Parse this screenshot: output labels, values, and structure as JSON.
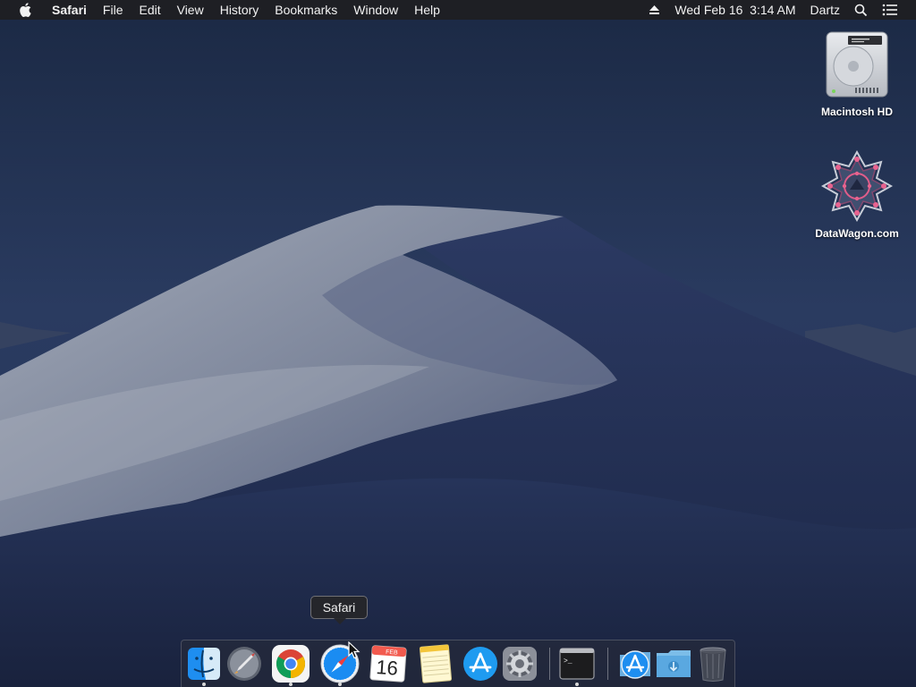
{
  "menubar": {
    "apple_icon": "apple-icon",
    "app_name": "Safari",
    "items": [
      "File",
      "Edit",
      "View",
      "History",
      "Bookmarks",
      "Window",
      "Help"
    ],
    "eject_icon": "eject-icon",
    "datetime": "Wed Feb 16  3:14 AM",
    "user": "Dartz",
    "search_icon": "spotlight-search-icon",
    "notifications_icon": "notification-center-icon"
  },
  "desktop_icons": [
    {
      "label": "Macintosh HD",
      "icon": "hard-drive-icon"
    },
    {
      "label": "DataWagon.com",
      "icon": "network-volume-icon"
    }
  ],
  "dock": {
    "items": [
      {
        "name": "Finder",
        "icon": "finder-icon",
        "running": true
      },
      {
        "name": "Launchpad",
        "icon": "launchpad-icon",
        "running": false
      },
      {
        "name": "Google Chrome",
        "icon": "chrome-icon",
        "running": true
      },
      {
        "name": "Safari",
        "icon": "safari-icon",
        "running": true
      },
      {
        "name": "Calendar",
        "icon": "calendar-icon",
        "running": false,
        "month": "FEB",
        "day": "16"
      },
      {
        "name": "Notes",
        "icon": "notes-icon",
        "running": false
      },
      {
        "name": "App Store",
        "icon": "app-store-icon",
        "running": false
      },
      {
        "name": "System Preferences",
        "icon": "system-preferences-icon",
        "running": false
      },
      {
        "name": "Terminal",
        "icon": "terminal-icon",
        "running": true,
        "prompt": ">_"
      },
      {
        "name": "Applications",
        "icon": "applications-folder-icon",
        "running": false
      },
      {
        "name": "Downloads",
        "icon": "downloads-folder-icon",
        "running": false
      },
      {
        "name": "Trash",
        "icon": "trash-icon",
        "running": false
      }
    ]
  },
  "tooltip": {
    "text": "Safari"
  },
  "colors": {
    "menubar_bg": "#1e1e22",
    "desktop_sky": "#1c2a45",
    "dune_light": "#8f97a8",
    "dune_shadow": "#2a3659"
  }
}
